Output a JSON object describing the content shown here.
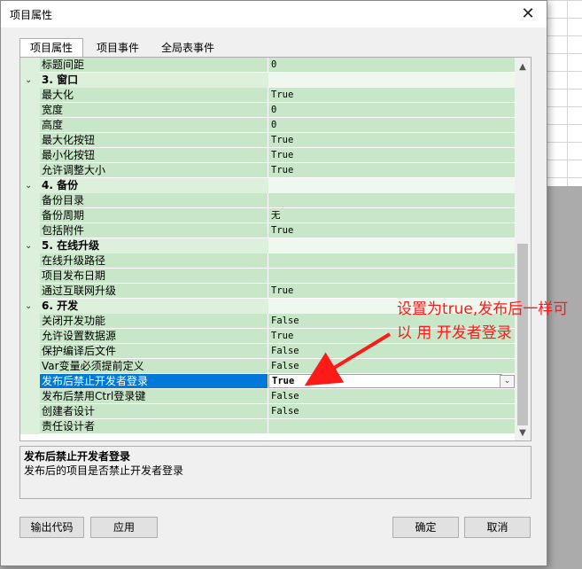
{
  "dialog": {
    "title": "项目属性",
    "close_glyph": "✕"
  },
  "tabs": [
    {
      "label": "项目属性",
      "active": true
    },
    {
      "label": "项目事件",
      "active": false
    },
    {
      "label": "全局表事件",
      "active": false
    }
  ],
  "property_rows": [
    {
      "type": "prop",
      "name": "标题间距",
      "value": "0"
    },
    {
      "type": "cat",
      "name": "3. 窗口"
    },
    {
      "type": "prop",
      "name": "最大化",
      "value": "True"
    },
    {
      "type": "prop",
      "name": "宽度",
      "value": "0"
    },
    {
      "type": "prop",
      "name": "高度",
      "value": "0"
    },
    {
      "type": "prop",
      "name": "最大化按钮",
      "value": "True"
    },
    {
      "type": "prop",
      "name": "最小化按钮",
      "value": "True"
    },
    {
      "type": "prop",
      "name": "允许调整大小",
      "value": "True"
    },
    {
      "type": "cat",
      "name": "4. 备份"
    },
    {
      "type": "prop",
      "name": "备份目录",
      "value": ""
    },
    {
      "type": "prop",
      "name": "备份周期",
      "value": "无"
    },
    {
      "type": "prop",
      "name": "包括附件",
      "value": "True"
    },
    {
      "type": "cat",
      "name": "5. 在线升级"
    },
    {
      "type": "prop",
      "name": "在线升级路径",
      "value": ""
    },
    {
      "type": "prop",
      "name": "项目发布日期",
      "value": ""
    },
    {
      "type": "prop",
      "name": "通过互联网升级",
      "value": "True"
    },
    {
      "type": "cat",
      "name": "6. 开发"
    },
    {
      "type": "prop",
      "name": "关闭开发功能",
      "value": "False"
    },
    {
      "type": "prop",
      "name": "允许设置数据源",
      "value": "True"
    },
    {
      "type": "prop",
      "name": "保护编译后文件",
      "value": "False"
    },
    {
      "type": "prop",
      "name": "Var变量必须提前定义",
      "value": "False"
    },
    {
      "type": "prop",
      "name": "发布后禁止开发者登录",
      "value": "True",
      "selected": true
    },
    {
      "type": "prop",
      "name": "发布后禁用Ctrl登录键",
      "value": "False"
    },
    {
      "type": "prop",
      "name": "创建者设计",
      "value": "False"
    },
    {
      "type": "prop",
      "name": "责任设计者",
      "value": ""
    }
  ],
  "description": {
    "title": "发布后禁止开发者登录",
    "text": "发布后的项目是否禁止开发者登录"
  },
  "buttons": {
    "export_code": "输出代码",
    "apply": "应用",
    "ok": "确定",
    "cancel": "取消"
  },
  "annotation": {
    "text": "设置为true,发布后一样可以 用    开发者登录",
    "color": "#ff1a1a"
  },
  "colors": {
    "row_bg": "#c8e6c8",
    "selected_bg": "#0078d7"
  }
}
